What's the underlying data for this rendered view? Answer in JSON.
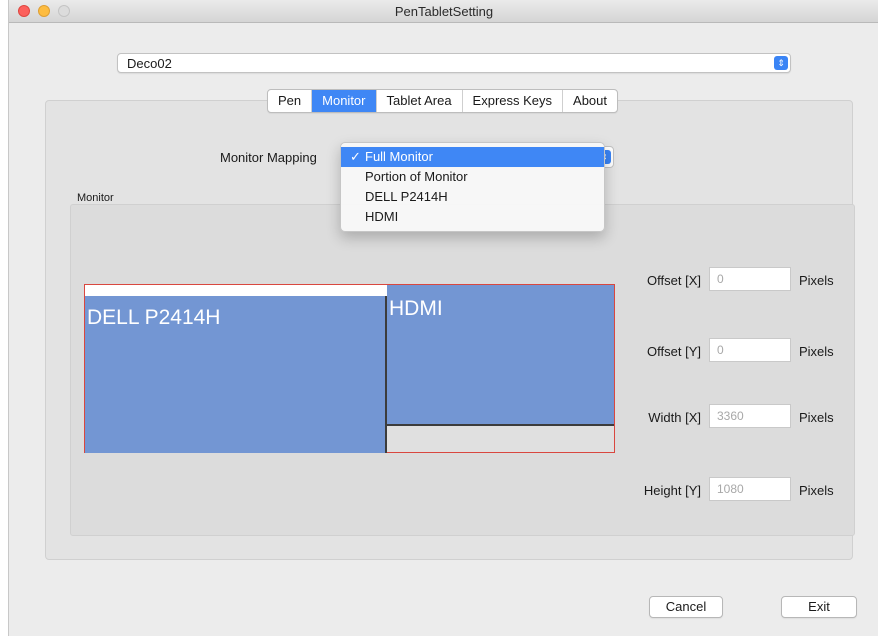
{
  "window": {
    "title": "PenTabletSetting"
  },
  "device": {
    "selected": "Deco02"
  },
  "tabs": [
    "Pen",
    "Monitor",
    "Tablet Area",
    "Express Keys",
    "About"
  ],
  "active_tab": "Monitor",
  "mapping": {
    "label": "Monitor Mapping",
    "options": [
      "Full Monitor",
      "Portion of Monitor",
      "DELL P2414H",
      "HDMI"
    ],
    "selected": "Full Monitor",
    "check": "✓"
  },
  "monitor": {
    "group_label": "Monitor",
    "screens": [
      {
        "name": "DELL P2414H"
      },
      {
        "name": "HDMI"
      }
    ]
  },
  "fields": [
    {
      "label": "Offset [X]",
      "value": "0",
      "unit": "Pixels"
    },
    {
      "label": "Offset [Y]",
      "value": "0",
      "unit": "Pixels"
    },
    {
      "label": "Width [X]",
      "value": "3360",
      "unit": "Pixels"
    },
    {
      "label": "Height [Y]",
      "value": "1080",
      "unit": "Pixels"
    }
  ],
  "buttons": {
    "cancel": "Cancel",
    "exit": "Exit"
  },
  "colors": {
    "accent": "#3f87f5",
    "screen_fill": "#7396d3",
    "mapping_outline": "#d9473f"
  },
  "icons": {
    "stepper": "up-down-chevron-icon"
  }
}
